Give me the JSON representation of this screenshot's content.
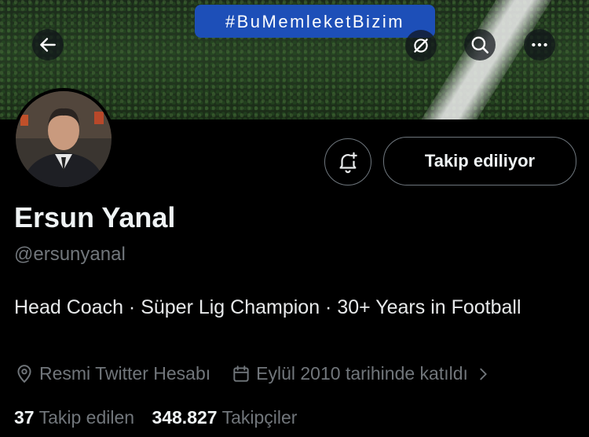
{
  "banner": {
    "hashtag": "#BuMemleketBizim"
  },
  "nav": {
    "back_icon": "arrow-left-icon",
    "grok_icon": "grok-icon",
    "search_icon": "search-icon",
    "more_icon": "more-horizontal-icon"
  },
  "profile": {
    "name": "Ersun Yanal",
    "handle": "@ersunyanal",
    "bio": "Head Coach · Süper Lig Champion · 30+ Years in Football",
    "location": "Resmi Twitter Hesabı",
    "joined": "Eylül 2010 tarihinde katıldı"
  },
  "actions": {
    "notify_icon": "bell-plus-icon",
    "follow_label": "Takip ediliyor"
  },
  "stats": {
    "following_count": "37",
    "following_label": "Takip edilen",
    "followers_count": "348.827",
    "followers_label": "Takipçiler"
  },
  "colors": {
    "background": "#000000",
    "hashtag_bg": "#1d4fb8",
    "text_primary": "#eff3f4",
    "text_secondary": "#71767b"
  }
}
